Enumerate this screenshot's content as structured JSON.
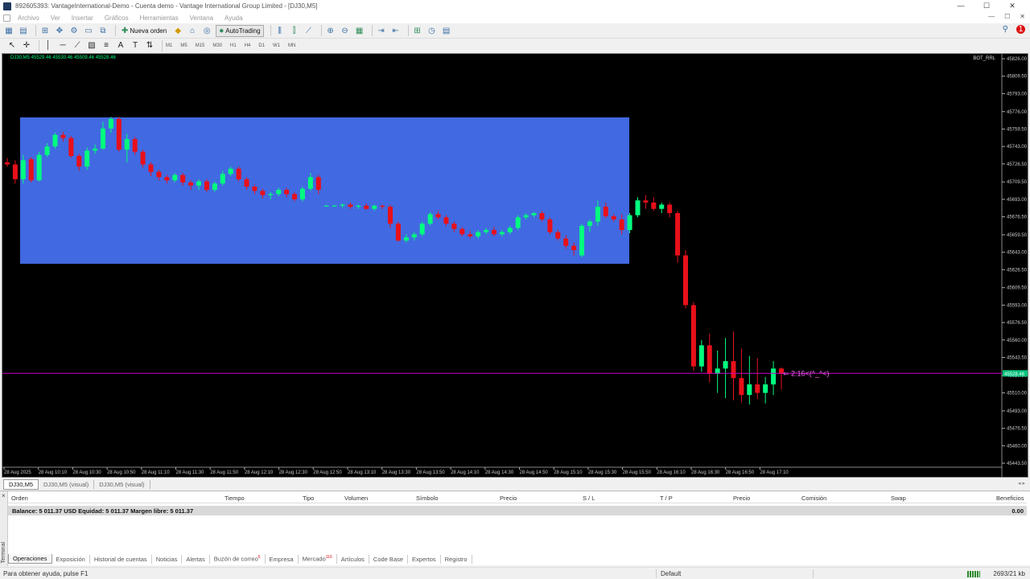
{
  "window": {
    "title": "892605393: VantageInternational-Demo - Cuenta demo - Vantage International Group Limited - [DJ30,M5]",
    "buttons": [
      "—",
      "☐",
      "✕"
    ]
  },
  "menu": {
    "items": [
      "Archivo",
      "Ver",
      "Insertar",
      "Gráficos",
      "Herramientas",
      "Ventana",
      "Ayuda"
    ],
    "right_controls": [
      "—",
      "☐",
      "✕"
    ]
  },
  "toolbar": {
    "new_order_label": "Nueva orden",
    "autotrading_label": "AutoTrading",
    "notification_count": "1"
  },
  "timeframes": [
    "M1",
    "M5",
    "M15",
    "M30",
    "H1",
    "H4",
    "D1",
    "W1",
    "MN"
  ],
  "chart": {
    "symbol_line": "DJ30,M5  45529.46 45530.46 45509.46 45528.46",
    "indicator_label": "BOT_RRL",
    "countdown_label": "2:16<(^_^<)",
    "current_price_label": "45528.46",
    "colors": {
      "background": "#000000",
      "bull": "#00ff7f",
      "bear": "#e8101a",
      "box": "#4169e1",
      "price_line": "#c800c8",
      "axis_text": "#c8c8c8"
    }
  },
  "chart_data": {
    "type": "candlestick",
    "symbol": "DJ30",
    "timeframe": "M5",
    "ylim": [
      45443.5,
      45826.0
    ],
    "y_ticks": [
      "45826.00",
      "45809.50",
      "45793.00",
      "45776.00",
      "45759.50",
      "45743.00",
      "45726.50",
      "45709.50",
      "45693.00",
      "45676.50",
      "45659.50",
      "45643.00",
      "45626.50",
      "45609.50",
      "45593.00",
      "45576.50",
      "45560.00",
      "45543.50",
      "45526.50",
      "45510.00",
      "45493.00",
      "45476.50",
      "45460.00",
      "45443.50"
    ],
    "x_ticks": [
      "28 Aug 2025",
      "28 Aug 10:10",
      "28 Aug 10:30",
      "28 Aug 10:50",
      "28 Aug 11:10",
      "28 Aug 11:30",
      "28 Aug 11:50",
      "28 Aug 12:10",
      "28 Aug 12:30",
      "28 Aug 12:50",
      "28 Aug 13:10",
      "28 Aug 13:30",
      "28 Aug 13:50",
      "28 Aug 14:10",
      "28 Aug 14:30",
      "28 Aug 14:50",
      "28 Aug 15:10",
      "28 Aug 15:30",
      "28 Aug 15:50",
      "28 Aug 16:10",
      "28 Aug 16:30",
      "28 Aug 16:50",
      "28 Aug 17:10"
    ],
    "current_price": 45528.46,
    "candles_ohlc": [
      [
        45728,
        45732,
        45724,
        45726
      ],
      [
        45726,
        45730,
        45708,
        45712
      ],
      [
        45712,
        45735,
        45708,
        45730
      ],
      [
        45731,
        45733,
        45709,
        45711
      ],
      [
        45711,
        45738,
        45710,
        45735
      ],
      [
        45735,
        45746,
        45733,
        45743
      ],
      [
        45743,
        45756,
        45741,
        45754
      ],
      [
        45754,
        45757,
        45748,
        45751
      ],
      [
        45751,
        45753,
        45732,
        45734
      ],
      [
        45734,
        45736,
        45720,
        45724
      ],
      [
        45724,
        45742,
        45721,
        45739
      ],
      [
        45739,
        45745,
        45736,
        45741
      ],
      [
        45741,
        45766,
        45740,
        45760
      ],
      [
        45760,
        45771,
        45756,
        45769
      ],
      [
        45769,
        45771,
        45738,
        45740
      ],
      [
        45740,
        45755,
        45728,
        45750
      ],
      [
        45750,
        45752,
        45735,
        45738
      ],
      [
        45738,
        45740,
        45723,
        45726
      ],
      [
        45726,
        45728,
        45715,
        45719
      ],
      [
        45719,
        45721,
        45711,
        45714
      ],
      [
        45714,
        45716,
        45708,
        45711
      ],
      [
        45711,
        45718,
        45709,
        45716
      ],
      [
        45716,
        45718,
        45706,
        45709
      ],
      [
        45709,
        45711,
        45702,
        45706
      ],
      [
        45706,
        45712,
        45702,
        45710
      ],
      [
        45710,
        45712,
        45700,
        45702
      ],
      [
        45702,
        45710,
        45700,
        45708
      ],
      [
        45708,
        45720,
        45706,
        45717
      ],
      [
        45717,
        45724,
        45715,
        45722
      ],
      [
        45722,
        45724,
        45710,
        45712
      ],
      [
        45712,
        45714,
        45702,
        45705
      ],
      [
        45705,
        45707,
        45698,
        45701
      ],
      [
        45701,
        45703,
        45694,
        45697
      ],
      [
        45697,
        45700,
        45693,
        45698
      ],
      [
        45698,
        45704,
        45696,
        45702
      ],
      [
        45702,
        45704,
        45695,
        45698
      ],
      [
        45698,
        45700,
        45691,
        45693
      ],
      [
        45693,
        45705,
        45691,
        45703
      ],
      [
        45703,
        45718,
        45701,
        45714
      ],
      [
        45714,
        45716,
        45698,
        45702
      ],
      [
        45687,
        45688,
        45686,
        45687
      ],
      [
        45687,
        45688,
        45686,
        45687
      ],
      [
        45687,
        45689,
        45685,
        45688
      ],
      [
        45688,
        45690,
        45684,
        45686
      ],
      [
        45686,
        45688,
        45684,
        45687
      ],
      [
        45687,
        45689,
        45683,
        45684
      ],
      [
        45684,
        45688,
        45682,
        45687
      ],
      [
        45687,
        45688,
        45684,
        45686
      ],
      [
        45686,
        45688,
        45666,
        45670
      ],
      [
        45670,
        45672,
        45653,
        45654
      ],
      [
        45654,
        45660,
        45652,
        45657
      ],
      [
        45657,
        45662,
        45654,
        45660
      ],
      [
        45660,
        45672,
        45658,
        45670
      ],
      [
        45670,
        45681,
        45668,
        45679
      ],
      [
        45679,
        45682,
        45674,
        45676
      ],
      [
        45676,
        45678,
        45668,
        45670
      ],
      [
        45670,
        45672,
        45662,
        45665
      ],
      [
        45665,
        45667,
        45658,
        45660
      ],
      [
        45660,
        45663,
        45656,
        45658
      ],
      [
        45658,
        45664,
        45656,
        45662
      ],
      [
        45662,
        45666,
        45660,
        45664
      ],
      [
        45664,
        45667,
        45658,
        45660
      ],
      [
        45660,
        45664,
        45658,
        45662
      ],
      [
        45662,
        45668,
        45660,
        45666
      ],
      [
        45666,
        45678,
        45664,
        45676
      ],
      [
        45676,
        45680,
        45674,
        45678
      ],
      [
        45678,
        45681,
        45676,
        45680
      ],
      [
        45680,
        45682,
        45672,
        45674
      ],
      [
        45674,
        45676,
        45660,
        45662
      ],
      [
        45662,
        45664,
        45654,
        45656
      ],
      [
        45656,
        45659,
        45646,
        45649
      ],
      [
        45649,
        45652,
        45640,
        45645
      ],
      [
        45640,
        45670,
        45638,
        45668
      ],
      [
        45668,
        45674,
        45662,
        45672
      ],
      [
        45672,
        45692,
        45668,
        45686
      ],
      [
        45686,
        45690,
        45675,
        45677
      ],
      [
        45677,
        45679,
        45672,
        45674
      ],
      [
        45674,
        45679,
        45660,
        45664
      ],
      [
        45664,
        45680,
        45661,
        45678
      ],
      [
        45678,
        45695,
        45676,
        45692
      ],
      [
        45692,
        45697,
        45684,
        45690
      ],
      [
        45690,
        45695,
        45682,
        45684
      ],
      [
        45684,
        45690,
        45680,
        45688
      ],
      [
        45688,
        45690,
        45676,
        45680
      ],
      [
        45680,
        45682,
        45633,
        45640
      ],
      [
        45640,
        45645,
        45590,
        45593
      ],
      [
        45593,
        45596,
        45531,
        45535
      ],
      [
        45535,
        45560,
        45530,
        45555
      ],
      [
        45555,
        45566,
        45520,
        45528
      ],
      [
        45528,
        45550,
        45510,
        45533
      ],
      [
        45533,
        45562,
        45505,
        45540
      ],
      [
        45540,
        45568,
        45503,
        45524
      ],
      [
        45524,
        45552,
        45501,
        45508
      ],
      [
        45508,
        45545,
        45499,
        45518
      ],
      [
        45518,
        45543,
        45504,
        45510
      ],
      [
        45510,
        45525,
        45500,
        45518
      ],
      [
        45518,
        45540,
        45508,
        45533
      ],
      [
        45533,
        45534,
        45513,
        45528
      ]
    ]
  },
  "chart_tabs": [
    "DJ30,M5",
    "DJ30,M5 (visual)",
    "DJ30,M5 (visual)"
  ],
  "terminal": {
    "side_label": "Terminal",
    "columns": [
      "Orden",
      "Tiempo",
      "Tipo",
      "Volumen",
      "Símbolo",
      "Precio",
      "S / L",
      "T / P",
      "Precio",
      "Comisión",
      "Swap",
      "Beneficios"
    ],
    "balance_text": "Balance: 5 011.37 USD  Equidad: 5 011.37  Margen libre: 5 011.37",
    "profit": "0.00",
    "tabs": [
      {
        "label": "Operaciones",
        "badge": ""
      },
      {
        "label": "Exposición",
        "badge": ""
      },
      {
        "label": "Historial de cuentas",
        "badge": ""
      },
      {
        "label": "Noticias",
        "badge": ""
      },
      {
        "label": "Alertas",
        "badge": ""
      },
      {
        "label": "Buzón de correo",
        "badge": "6"
      },
      {
        "label": "Empresa",
        "badge": ""
      },
      {
        "label": "Mercado",
        "badge": "116"
      },
      {
        "label": "Artículos",
        "badge": ""
      },
      {
        "label": "Code Base",
        "badge": ""
      },
      {
        "label": "Expertos",
        "badge": ""
      },
      {
        "label": "Registro",
        "badge": ""
      }
    ]
  },
  "status": {
    "help": "Para obtener ayuda, pulse F1",
    "profile": "Default",
    "traffic": "2693/21 kb"
  }
}
